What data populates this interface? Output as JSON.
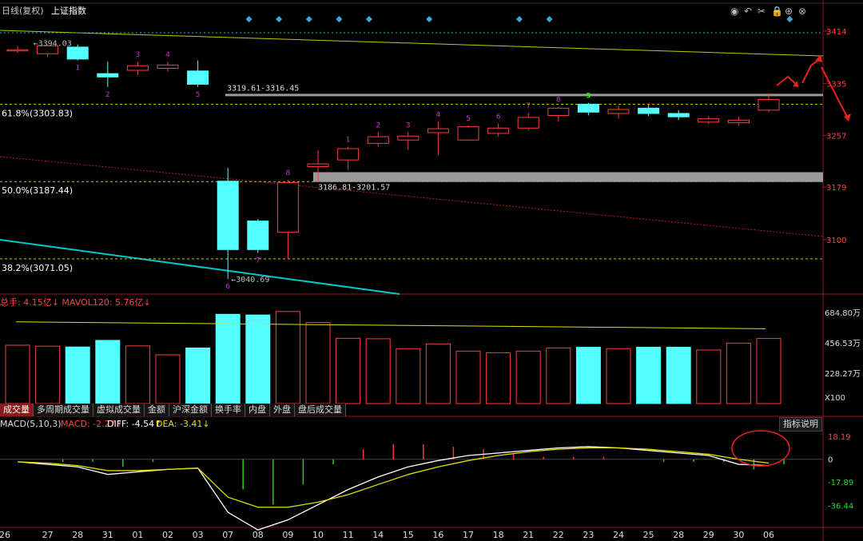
{
  "header": {
    "title": "日线(复权)",
    "index_name": "上证指数"
  },
  "toolbar_icons": [
    "eye-icon",
    "undo-icon",
    "scissors-icon",
    "lock-icon",
    "plus-circle-icon",
    "close-circle-icon"
  ],
  "chart_data": [
    {
      "type": "candlestick",
      "title": "日线(复权) 上证指数",
      "x_dates": [
        "26",
        "27",
        "28",
        "31",
        "01",
        "02",
        "03",
        "07",
        "08",
        "09",
        "10",
        "11",
        "14",
        "15",
        "16",
        "17",
        "18",
        "21",
        "22",
        "23",
        "24",
        "25",
        "28",
        "29",
        "30",
        "06"
      ],
      "ohlc": [
        [
          3386,
          3392,
          3381,
          3386
        ],
        [
          3380,
          3394.03,
          3375,
          3392
        ],
        [
          3390,
          3394,
          3370,
          3372
        ],
        [
          3350,
          3368,
          3330,
          3345
        ],
        [
          3355,
          3368,
          3348,
          3362
        ],
        [
          3358,
          3368,
          3353,
          3363
        ],
        [
          3354,
          3370,
          3330,
          3334
        ],
        [
          3188,
          3208,
          3040.69,
          3085
        ],
        [
          3128,
          3131,
          3080,
          3085
        ],
        [
          3111,
          3190,
          3070,
          3186
        ],
        [
          3210,
          3235,
          3186.81,
          3214
        ],
        [
          3220,
          3240,
          3205,
          3237
        ],
        [
          3245,
          3262,
          3240,
          3255
        ],
        [
          3250,
          3262,
          3235,
          3256
        ],
        [
          3261,
          3278,
          3227,
          3267
        ],
        [
          3250,
          3272,
          3249,
          3270
        ],
        [
          3260,
          3275,
          3255,
          3268
        ],
        [
          3268,
          3291,
          3265,
          3284
        ],
        [
          3287,
          3300,
          3278,
          3298
        ],
        [
          3304,
          3306,
          3287,
          3292
        ],
        [
          3290,
          3302,
          3282,
          3296
        ],
        [
          3298,
          3303,
          3286,
          3290
        ],
        [
          3290,
          3295,
          3280,
          3285
        ],
        [
          3277,
          3286,
          3274,
          3282
        ],
        [
          3276,
          3285,
          3272,
          3280
        ],
        [
          3295,
          3320,
          3292,
          3311
        ]
      ],
      "count_labels": [
        "",
        "",
        "1",
        "2",
        "3",
        "4",
        "5",
        "6",
        "7",
        "8",
        "",
        "1",
        "2",
        "3",
        "4",
        "5",
        "6",
        "7",
        "8",
        "9",
        "",
        "",
        "",
        "",
        "",
        ""
      ],
      "y_ticks": [
        3414,
        3335,
        3257,
        3179,
        3100
      ],
      "ylim": [
        3030,
        3420
      ],
      "annotations": {
        "high_label": "3394.03",
        "low_label": "3040.69",
        "gap_upper": "3319.61-3316.45",
        "gap_lower": "3186.81-3201.57",
        "fib_618": "61.8%(3303.83)",
        "fib_500": "50.0%(3187.44)",
        "fib_382": "38.2%(3071.05)"
      }
    },
    {
      "type": "bar",
      "title": "总手: 4.15亿↓ MAVOL120: 5.76亿↓",
      "series_name": "总手",
      "values": [
        4.25,
        4.18,
        4.12,
        4.6,
        4.2,
        3.55,
        4.05,
        6.5,
        6.45,
        6.7,
        5.9,
        4.75,
        4.72,
        4.0,
        4.35,
        3.82,
        3.7,
        3.82,
        4.05,
        4.1,
        4.0,
        4.1,
        4.1,
        3.9,
        4.4,
        4.74
      ],
      "ma_name": "MAVOL120",
      "ma_start": 5.95,
      "ma_end": 5.45,
      "y_ticks": [
        "684.80万",
        "456.53万",
        "228.27万"
      ],
      "unit_label": "X100",
      "ylim": [
        0,
        7.1
      ]
    },
    {
      "type": "line",
      "title": "MACD(5,10,3)",
      "macd_label": "MACD: -2.27↑",
      "diff_label": "DIFF: -4.54↑",
      "dea_label": "DEA: -3.41↓",
      "diff": [
        -2,
        -4,
        -6,
        -12,
        -10,
        -8,
        -7,
        -42,
        -56,
        -48,
        -36,
        -24,
        -14,
        -6,
        -1,
        3,
        5,
        7,
        9,
        10,
        9,
        7,
        5,
        3,
        -4,
        -5
      ],
      "dea": [
        -2,
        -3,
        -5,
        -9,
        -9,
        -8,
        -7,
        -30,
        -38,
        -38,
        -34,
        -28,
        -20,
        -12,
        -6,
        -1,
        3,
        6,
        8,
        9,
        9,
        8,
        6,
        4,
        0,
        -3
      ],
      "y_ticks": [
        "18.19",
        "0",
        "-17.89",
        "-36.44"
      ],
      "ylim": [
        -54,
        22
      ]
    }
  ],
  "tabs": [
    "成交量",
    "多周期成交量",
    "虚拟成交量",
    "金额",
    "沪深金额",
    "换手率",
    "内盘",
    "外盘",
    "盘后成交量"
  ],
  "explain_button": "指标说明",
  "colors": {
    "up": "#ff3b3b",
    "down": "#54ffff",
    "diff": "#ffffff",
    "dea": "#e0e000",
    "grid": "#8b1a1a",
    "fib": "#c8c800",
    "trend": "#c8c800",
    "support": "#00c8c8"
  }
}
